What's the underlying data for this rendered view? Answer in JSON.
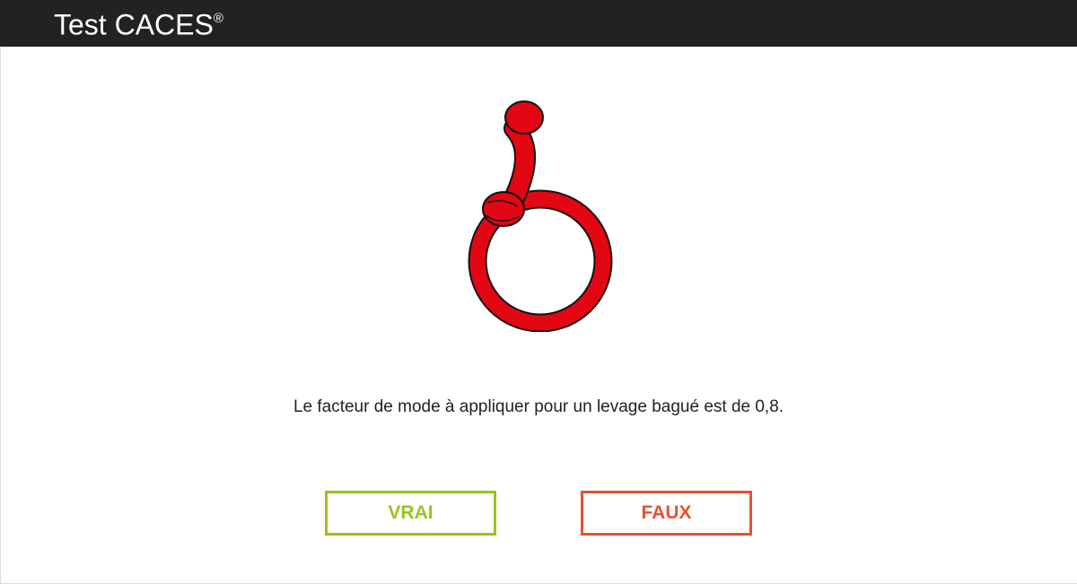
{
  "header": {
    "title": "Test CACES",
    "title_mark": "®"
  },
  "illustration": {
    "icon": "choker-hitch-sling-icon",
    "sling_color": "#e30613"
  },
  "question": {
    "text": "Le facteur de mode à appliquer pour un levage bagué est de 0,8."
  },
  "answers": {
    "true_label": "VRAI",
    "false_label": "FAUX"
  },
  "colors": {
    "header_bg": "#222222",
    "true_accent": "#9ac31c",
    "false_accent": "#e8502f"
  }
}
